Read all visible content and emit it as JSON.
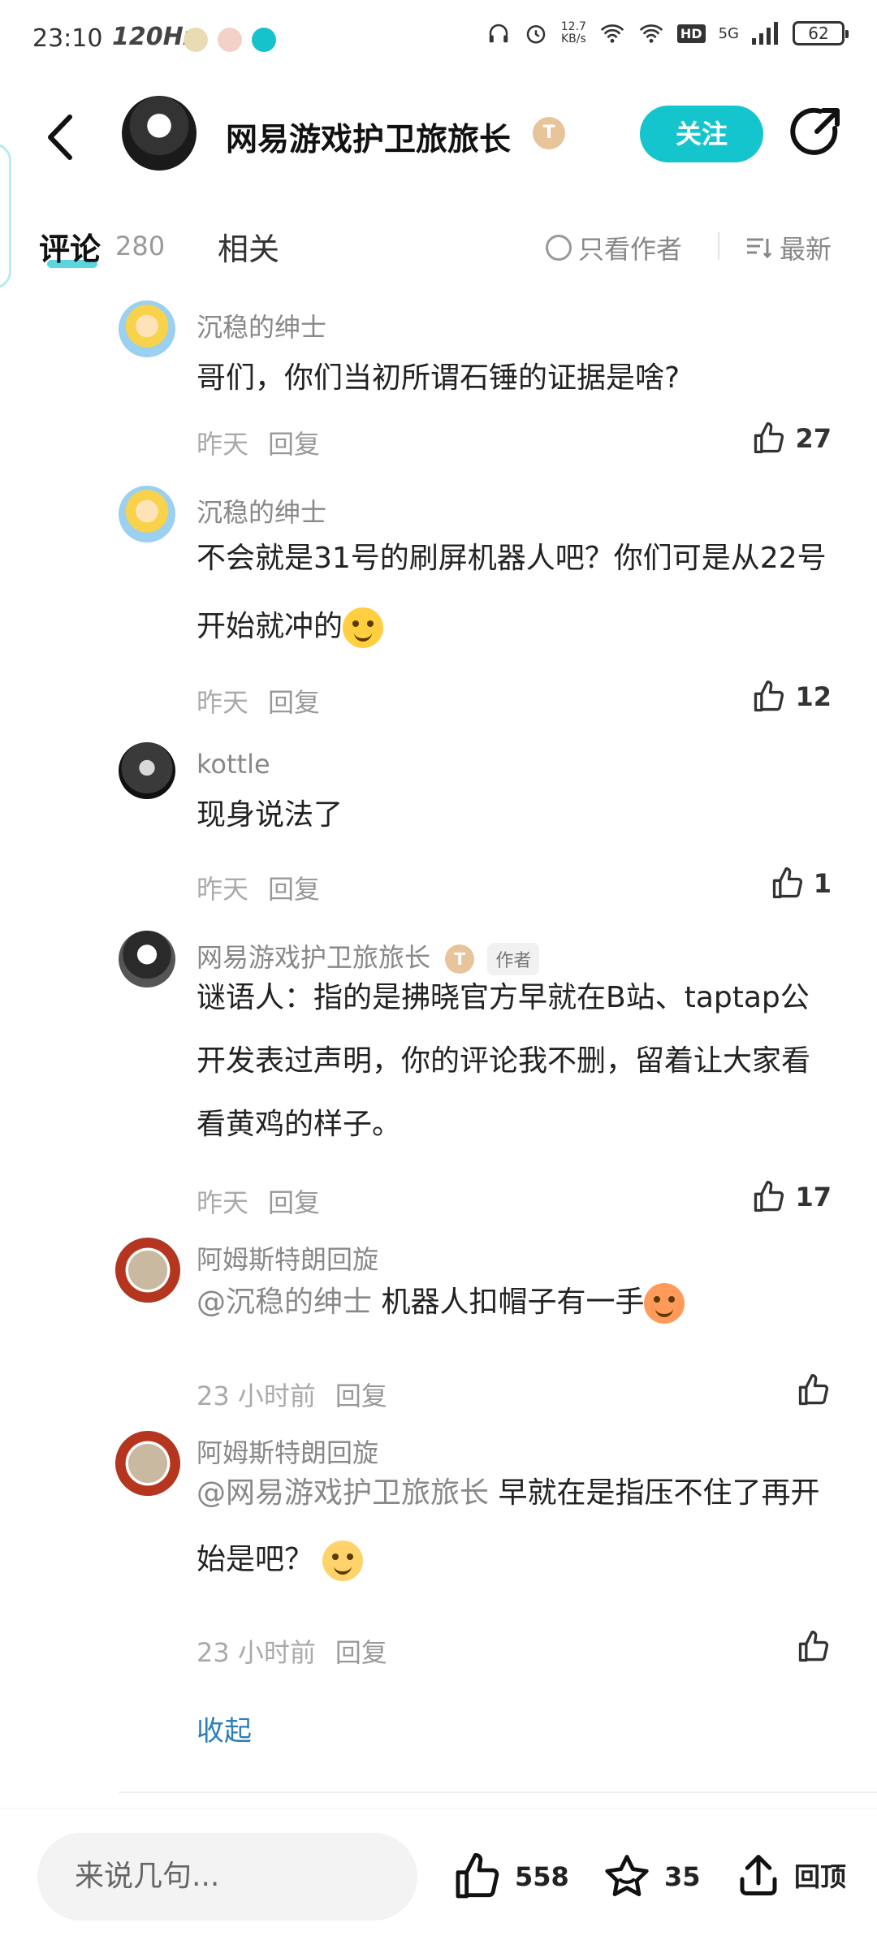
{
  "status_bar": {
    "time": "23:10",
    "refresh_rate": "120Hz",
    "speed_value": "12.7",
    "speed_unit": "KB/s",
    "hd_label": "HD",
    "network": "5G",
    "battery": "62"
  },
  "header": {
    "title": "网易游戏护卫旅旅长",
    "badge_letter": "T",
    "follow_label": "关注"
  },
  "tabs": {
    "comments_label": "评论",
    "comments_count": "280",
    "related_label": "相关",
    "only_author_label": "只看作者",
    "sort_label": "最新"
  },
  "comments": [
    {
      "user": "沉稳的绅士",
      "text": "哥们，你们当初所谓石锤的证据是啥?",
      "time": "昨天",
      "reply": "回复",
      "likes": "27"
    },
    {
      "user": "沉稳的绅士",
      "text": "不会就是31号的刷屏机器人吧？你们可是从22号开始就冲的",
      "time": "昨天",
      "reply": "回复",
      "likes": "12"
    },
    {
      "user": "kottle",
      "text": "现身说法了",
      "time": "昨天",
      "reply": "回复",
      "likes": "1"
    },
    {
      "user": "网易游戏护卫旅旅长",
      "author_tag": "作者",
      "text": "谜语人：指的是拂晓官方早就在B站、taptap公开发表过声明，你的评论我不删，留着让大家看看黄鸡的样子。",
      "time": "昨天",
      "reply": "回复",
      "likes": "17"
    },
    {
      "user": "阿姆斯特朗回旋",
      "mention": "@沉稳的绅士",
      "text": "机器人扣帽子有一手",
      "time": "23 小时前",
      "reply": "回复",
      "likes": ""
    },
    {
      "user": "阿姆斯特朗回旋",
      "mention": "@网易游戏护卫旅旅长",
      "text": "早就在是指压不住了再开始是吧？",
      "time": "23 小时前",
      "reply": "回复",
      "likes": ""
    }
  ],
  "collapse_label": "收起",
  "bottom_bar": {
    "input_placeholder": "来说几句...",
    "likes": "558",
    "favorites": "35",
    "top_label": "回顶"
  },
  "colors": {
    "accent": "#15c5ce",
    "link": "#2a7fb8",
    "badge": "#e8c49a"
  }
}
